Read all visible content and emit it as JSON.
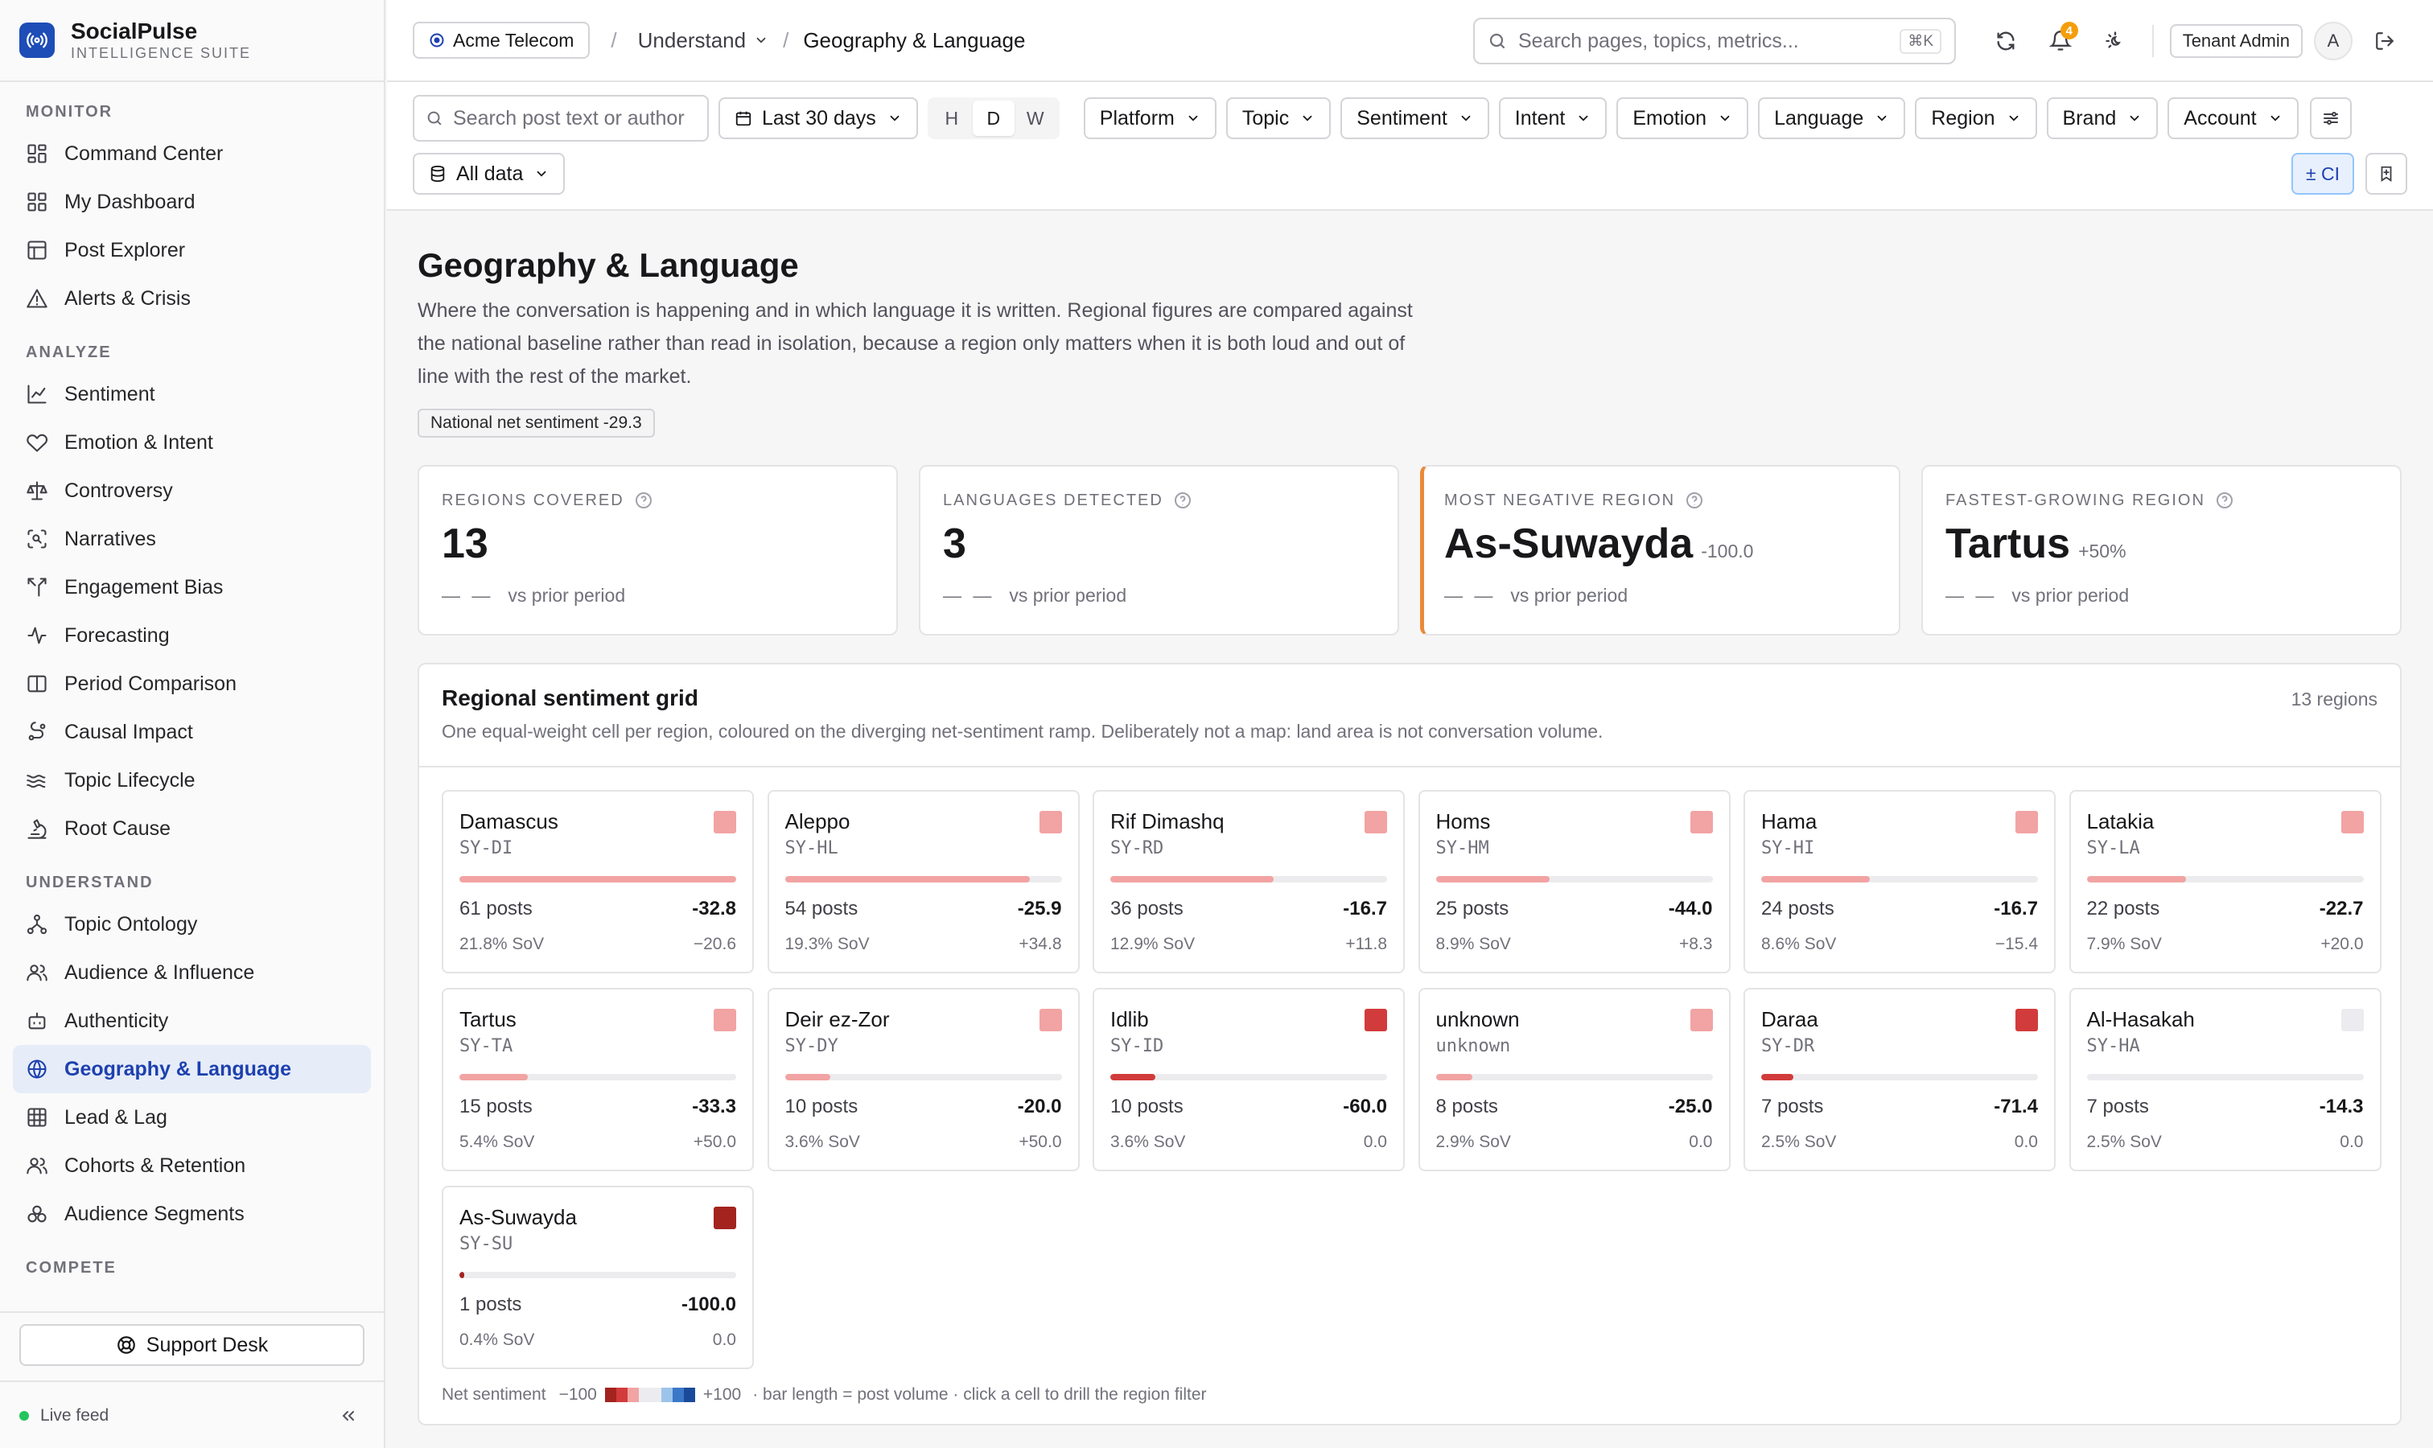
{
  "app": {
    "name": "SocialPulse",
    "subtitle": "INTELLIGENCE SUITE"
  },
  "sidebar": {
    "sections": [
      {
        "title": "MONITOR",
        "items": [
          {
            "label": "Command Center",
            "icon": "layout-grid-icon"
          },
          {
            "label": "My Dashboard",
            "icon": "dashboard-icon"
          },
          {
            "label": "Post Explorer",
            "icon": "table-icon"
          },
          {
            "label": "Alerts & Crisis",
            "icon": "alert-triangle-icon"
          }
        ]
      },
      {
        "title": "ANALYZE",
        "items": [
          {
            "label": "Sentiment",
            "icon": "line-chart-icon"
          },
          {
            "label": "Emotion & Intent",
            "icon": "heart-icon"
          },
          {
            "label": "Controversy",
            "icon": "scale-icon"
          },
          {
            "label": "Narratives",
            "icon": "scan-search-icon"
          },
          {
            "label": "Engagement Bias",
            "icon": "split-icon"
          },
          {
            "label": "Forecasting",
            "icon": "activity-icon"
          },
          {
            "label": "Period Comparison",
            "icon": "columns-icon"
          },
          {
            "label": "Causal Impact",
            "icon": "flow-icon"
          },
          {
            "label": "Topic Lifecycle",
            "icon": "waves-icon"
          },
          {
            "label": "Root Cause",
            "icon": "microscope-icon"
          }
        ]
      },
      {
        "title": "UNDERSTAND",
        "items": [
          {
            "label": "Topic Ontology",
            "icon": "network-icon"
          },
          {
            "label": "Audience & Influence",
            "icon": "users-icon"
          },
          {
            "label": "Authenticity",
            "icon": "bot-icon"
          },
          {
            "label": "Geography & Language",
            "icon": "globe-icon",
            "active": true
          },
          {
            "label": "Lead & Lag",
            "icon": "grid-icon"
          },
          {
            "label": "Cohorts & Retention",
            "icon": "users-icon"
          },
          {
            "label": "Audience Segments",
            "icon": "segments-icon"
          }
        ]
      },
      {
        "title": "COMPETE",
        "items": []
      }
    ],
    "support_label": "Support Desk",
    "live_label": "Live feed"
  },
  "topbar": {
    "tenant": "Acme Telecom",
    "crumb_section": "Understand",
    "crumb_current": "Geography & Language",
    "search_placeholder": "Search pages, topics, metrics...",
    "search_shortcut": "⌘K",
    "notification_count": "4",
    "role": "Tenant Admin",
    "avatar_initial": "A"
  },
  "filters": {
    "search_placeholder": "Search post text or author",
    "date_range": "Last 30 days",
    "granularity": [
      "H",
      "D",
      "W"
    ],
    "granularity_selected": "D",
    "dropdowns": [
      "Platform",
      "Topic",
      "Sentiment",
      "Intent",
      "Emotion",
      "Language",
      "Region",
      "Brand",
      "Account"
    ],
    "dataset": "All data",
    "ci_label": "± CI"
  },
  "page": {
    "title": "Geography & Language",
    "description": "Where the conversation is happening and in which language it is written. Regional figures are compared against the national baseline rather than read in isolation, because a region only matters when it is both loud and out of line with the rest of the market.",
    "baseline_chip": "National net sentiment -29.3"
  },
  "kpis": [
    {
      "label": "REGIONS COVERED",
      "value": "13",
      "delta": "",
      "prior": "vs prior period",
      "dash": "— —"
    },
    {
      "label": "LANGUAGES DETECTED",
      "value": "3",
      "delta": "",
      "prior": "vs prior period",
      "dash": "— —"
    },
    {
      "label": "MOST NEGATIVE REGION",
      "value": "As-Suwayda",
      "delta": "-100.0",
      "prior": "vs prior period",
      "dash": "— —"
    },
    {
      "label": "FASTEST-GROWING REGION",
      "value": "Tartus",
      "delta": "+50%",
      "prior": "vs prior period",
      "dash": "— —"
    }
  ],
  "grid": {
    "title": "Regional sentiment grid",
    "subtitle": "One equal-weight cell per region, coloured on the diverging net-sentiment ramp. Deliberately not a map: land area is not conversation volume.",
    "count_label": "13 regions",
    "cells": [
      {
        "name": "Damascus",
        "code": "SY-DI",
        "posts": "61 posts",
        "net": "-32.8",
        "sov": "21.8% SoV",
        "delta": "−20.6",
        "volume_share": 1.0,
        "color": "#f2a3a3",
        "bar_color": "#f2a3a3"
      },
      {
        "name": "Aleppo",
        "code": "SY-HL",
        "posts": "54 posts",
        "net": "-25.9",
        "sov": "19.3% SoV",
        "delta": "+34.8",
        "volume_share": 0.885,
        "color": "#f2a3a3",
        "bar_color": "#f2a3a3"
      },
      {
        "name": "Rif Dimashq",
        "code": "SY-RD",
        "posts": "36 posts",
        "net": "-16.7",
        "sov": "12.9% SoV",
        "delta": "+11.8",
        "volume_share": 0.59,
        "color": "#f2a3a3",
        "bar_color": "#f2a3a3"
      },
      {
        "name": "Homs",
        "code": "SY-HM",
        "posts": "25 posts",
        "net": "-44.0",
        "sov": "8.9% SoV",
        "delta": "+8.3",
        "volume_share": 0.41,
        "color": "#f2a3a3",
        "bar_color": "#f2a3a3"
      },
      {
        "name": "Hama",
        "code": "SY-HI",
        "posts": "24 posts",
        "net": "-16.7",
        "sov": "8.6% SoV",
        "delta": "−15.4",
        "volume_share": 0.393,
        "color": "#f2a3a3",
        "bar_color": "#f2a3a3"
      },
      {
        "name": "Latakia",
        "code": "SY-LA",
        "posts": "22 posts",
        "net": "-22.7",
        "sov": "7.9% SoV",
        "delta": "+20.0",
        "volume_share": 0.36,
        "color": "#f2a3a3",
        "bar_color": "#f2a3a3"
      },
      {
        "name": "Tartus",
        "code": "SY-TA",
        "posts": "15 posts",
        "net": "-33.3",
        "sov": "5.4% SoV",
        "delta": "+50.0",
        "volume_share": 0.246,
        "color": "#f2a3a3",
        "bar_color": "#f2a3a3"
      },
      {
        "name": "Deir ez-Zor",
        "code": "SY-DY",
        "posts": "10 posts",
        "net": "-20.0",
        "sov": "3.6% SoV",
        "delta": "+50.0",
        "volume_share": 0.164,
        "color": "#f2a3a3",
        "bar_color": "#f2a3a3"
      },
      {
        "name": "Idlib",
        "code": "SY-ID",
        "posts": "10 posts",
        "net": "-60.0",
        "sov": "3.6% SoV",
        "delta": "0.0",
        "volume_share": 0.164,
        "color": "#d23b3b",
        "bar_color": "#d23b3b"
      },
      {
        "name": "unknown",
        "code": "unknown",
        "posts": "8 posts",
        "net": "-25.0",
        "sov": "2.9% SoV",
        "delta": "0.0",
        "volume_share": 0.131,
        "color": "#f2a3a3",
        "bar_color": "#f2a3a3"
      },
      {
        "name": "Daraa",
        "code": "SY-DR",
        "posts": "7 posts",
        "net": "-71.4",
        "sov": "2.5% SoV",
        "delta": "0.0",
        "volume_share": 0.115,
        "color": "#d23b3b",
        "bar_color": "#d23b3b"
      },
      {
        "name": "Al-Hasakah",
        "code": "SY-HA",
        "posts": "7 posts",
        "net": "-14.3",
        "sov": "2.5% SoV",
        "delta": "0.0",
        "volume_share": 0.115,
        "color": "#ececf0",
        "bar_color": "#ececf0"
      },
      {
        "name": "As-Suwayda",
        "code": "SY-SU",
        "posts": "1 posts",
        "net": "-100.0",
        "sov": "0.4% SoV",
        "delta": "0.0",
        "volume_share": 0.016,
        "color": "#a3231f",
        "bar_color": "#a3231f"
      }
    ],
    "legend": {
      "label": "Net sentiment",
      "min": "−100",
      "max": "+100",
      "note": "· bar length = post volume · click a cell to drill the region filter",
      "ramp": [
        "#a3231f",
        "#d23b3b",
        "#f2a3a3",
        "#ececf0",
        "#ececf0",
        "#9cc4ea",
        "#3b78c8",
        "#1c4a9a"
      ]
    }
  }
}
